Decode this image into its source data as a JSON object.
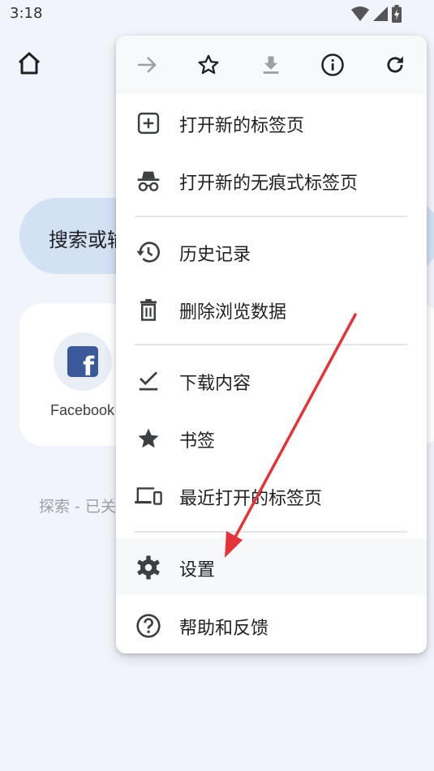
{
  "status_bar": {
    "time": "3:18",
    "icons": [
      "wifi-icon",
      "signal-icon",
      "battery-charging-icon"
    ]
  },
  "background": {
    "home_icon": "home-icon",
    "search_placeholder": "搜索或输",
    "shortcut": {
      "label": "Facebook",
      "logo_letter": "f"
    },
    "discover_text": "探索 - 已关"
  },
  "menu": {
    "toolbar": [
      {
        "icon": "forward-arrow-icon",
        "enabled": false
      },
      {
        "icon": "star-outline-icon",
        "enabled": true
      },
      {
        "icon": "download-icon",
        "enabled": false
      },
      {
        "icon": "info-icon",
        "enabled": true
      },
      {
        "icon": "refresh-icon",
        "enabled": true
      }
    ],
    "items": [
      {
        "label": "打开新的标签页",
        "icon": "new-tab-icon"
      },
      {
        "label": "打开新的无痕式标签页",
        "icon": "incognito-icon"
      },
      {
        "label": "历史记录",
        "icon": "history-icon"
      },
      {
        "label": "删除浏览数据",
        "icon": "trash-icon"
      },
      {
        "label": "下载内容",
        "icon": "downloads-check-icon"
      },
      {
        "label": "书签",
        "icon": "star-filled-icon"
      },
      {
        "label": "最近打开的标签页",
        "icon": "devices-icon"
      },
      {
        "label": "设置",
        "icon": "gear-icon"
      },
      {
        "label": "帮助和反馈",
        "icon": "help-icon"
      }
    ]
  },
  "colors": {
    "page_bg": "#f1f4fb",
    "search_pill": "#d3e1f5",
    "menu_icon": "#3c4043",
    "disabled_icon": "#9aa0a6",
    "annotation_arrow": "#e5333a"
  }
}
